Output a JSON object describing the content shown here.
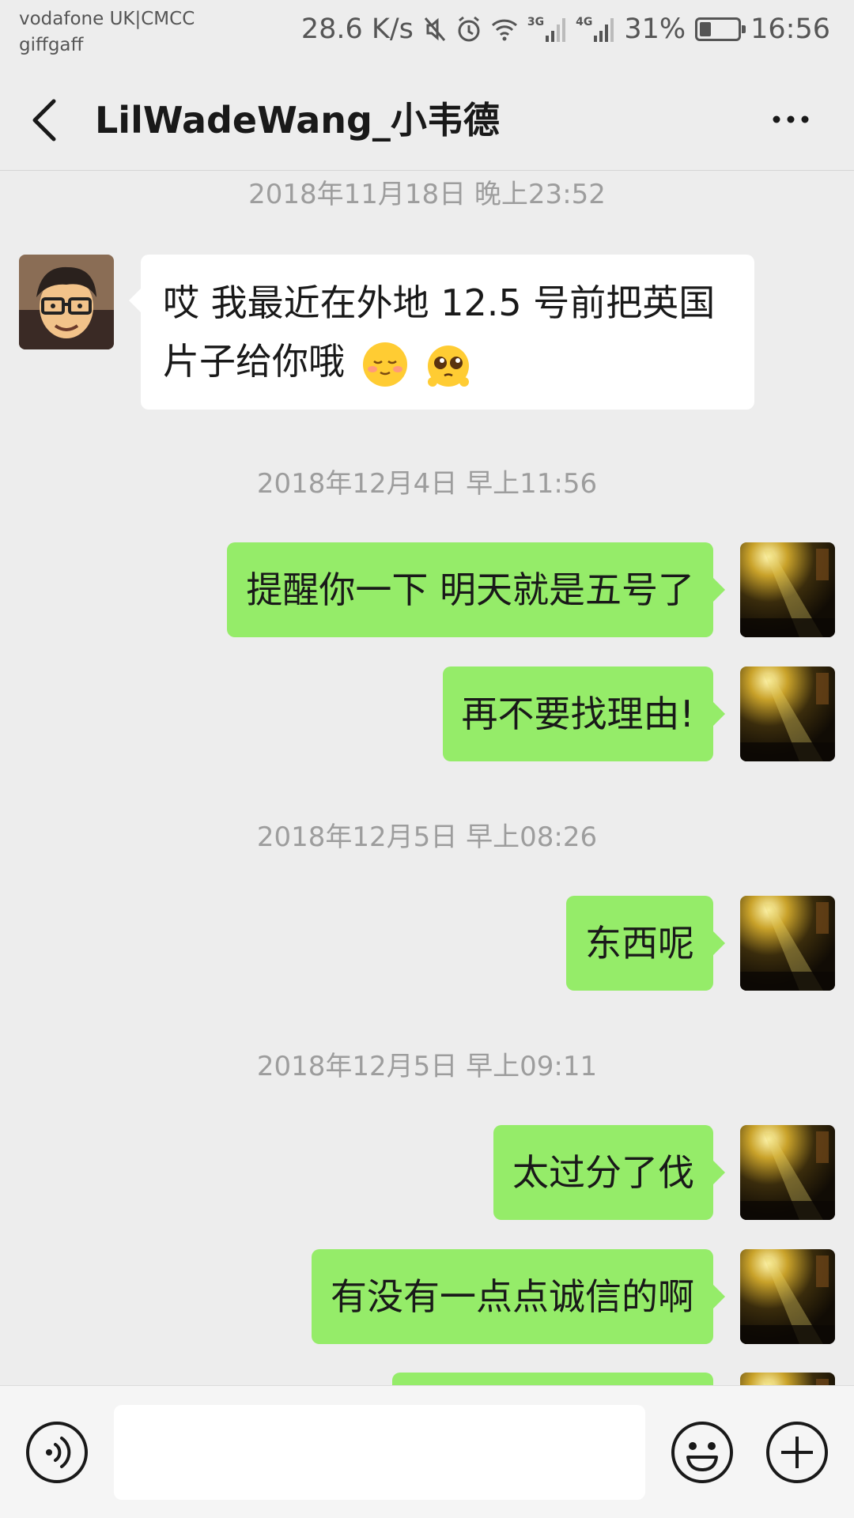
{
  "status_bar": {
    "carrier_line1": "vodafone UK|CMCC",
    "carrier_line2": "giffgaff",
    "net_speed": "28.6 K/s",
    "net_3g": "3G",
    "net_4g": "4G",
    "battery_percent": "31%",
    "battery_level": 0.31,
    "time": "16:56"
  },
  "header": {
    "title": "LilWadeWang_小韦德"
  },
  "timestamps": [
    "2018年11月18日 晚上23:52",
    "2018年12月4日 早上11:56",
    "2018年12月5日 早上08:26",
    "2018年12月5日 早上09:11"
  ],
  "messages": {
    "incoming_1": "哎 我最近在外地 12.5 号前把英国片子给你哦",
    "outgoing_1": "提醒你一下 明天就是五号了",
    "outgoing_2": "再不要找理由!",
    "outgoing_3": "东西呢",
    "outgoing_4": "太过分了伐",
    "outgoing_5": "有没有一点点诚信的啊"
  },
  "input": {
    "value": "",
    "placeholder": ""
  },
  "icons": {
    "back": "back-arrow-icon",
    "more": "more-icon",
    "voice": "voice-icon",
    "emoji": "emoji-icon",
    "plus": "plus-icon"
  },
  "colors": {
    "background": "#ededed",
    "outgoing_bubble": "#95ec69",
    "incoming_bubble": "#ffffff",
    "timestamp": "#9d9d9d"
  }
}
